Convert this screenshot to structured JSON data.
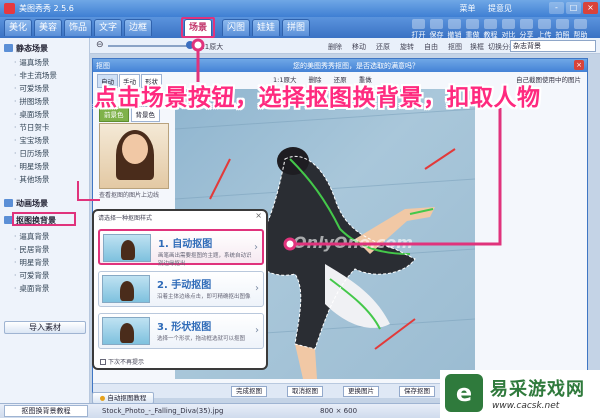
{
  "window": {
    "title": "美图秀秀 2.5.6",
    "menu": [
      "菜单",
      "提意见"
    ],
    "controls": [
      "-",
      "□",
      "×"
    ]
  },
  "tabs": [
    {
      "label": "美化"
    },
    {
      "label": "美容"
    },
    {
      "label": "饰品"
    },
    {
      "label": "文字"
    },
    {
      "label": "边框"
    },
    {
      "label": "场景"
    },
    {
      "label": "闪图"
    },
    {
      "label": "娃娃"
    },
    {
      "label": "拼图"
    }
  ],
  "active_tab": "场景",
  "toolbar_tools": [
    "打开",
    "保存",
    "撤销",
    "重做",
    "教程",
    "对比",
    "分享",
    "上传",
    "拍照",
    "帮助"
  ],
  "sidebar": {
    "static_section": "静态场景",
    "static_items": [
      "逼真场景",
      "非主流场景",
      "可爱场景",
      "拼图场景",
      "桌面场景",
      "节日贺卡",
      "宝宝场景",
      "日历场景",
      "明星场景",
      "其他场景"
    ],
    "animated_section": "动画场景",
    "cutout_section": "抠图换背景",
    "cutout_items": [
      "逼真背景",
      "民居背景",
      "明星背景",
      "可爱背景",
      "桌面背景"
    ],
    "import_button": "导入素材"
  },
  "toolbar2": {
    "zoom_label": "1:1原大",
    "actions": [
      "删除",
      "移动",
      "还原",
      "旋转",
      "自由",
      "抠图",
      "换框"
    ],
    "switch_label": "切换分类",
    "scene_select": "杂志背景"
  },
  "dialog": {
    "title_left": "抠图",
    "title_center": "您的美图秀秀抠图，是否选取的满意吗？",
    "tabs": [
      "自动",
      "手动",
      "形状"
    ],
    "tools": [
      "1:1原大",
      "删除",
      "还原",
      "重做"
    ],
    "right_label": "自己截图使用中的图片",
    "cut_tabs": [
      "前景色",
      "背景色"
    ],
    "thumb_caption": "查看抠图的图片上边线",
    "watermark": "OnlyOne.com",
    "bottom_buttons": [
      "完成抠图",
      "取消抠图",
      "更换图片",
      "保存抠图"
    ]
  },
  "modes": {
    "title": "请选择一种抠图样式",
    "items": [
      {
        "name": "1. 自动抠图",
        "desc": "画笔画出需要抠图的主题，系统自动识别边缘抠出"
      },
      {
        "name": "2. 手动抠图",
        "desc": "沿着主体边缘点击，即可精确抠出图像"
      },
      {
        "name": "3. 形状抠图",
        "desc": "选择一个形状，拖动框选就可以抠图"
      }
    ],
    "checkbox": "下次不再提示",
    "tutorial_button": "自动抠图教程"
  },
  "annotation": "点击场景按钮，选择抠图换背景，扣取人物",
  "status": {
    "left_button": "抠图换背景教程",
    "filename": "Stock_Photo_-_Falling_Diva(35).jpg",
    "size": "800 × 600"
  },
  "watermark_logo": {
    "name": "易采游戏网",
    "url": "www.cacsk.net"
  },
  "colors": {
    "accent_pink": "#e0337c",
    "annotation_pink": "#ff2a7f",
    "title_blue": "#4482d6",
    "logo_green": "#2f7a3c"
  }
}
